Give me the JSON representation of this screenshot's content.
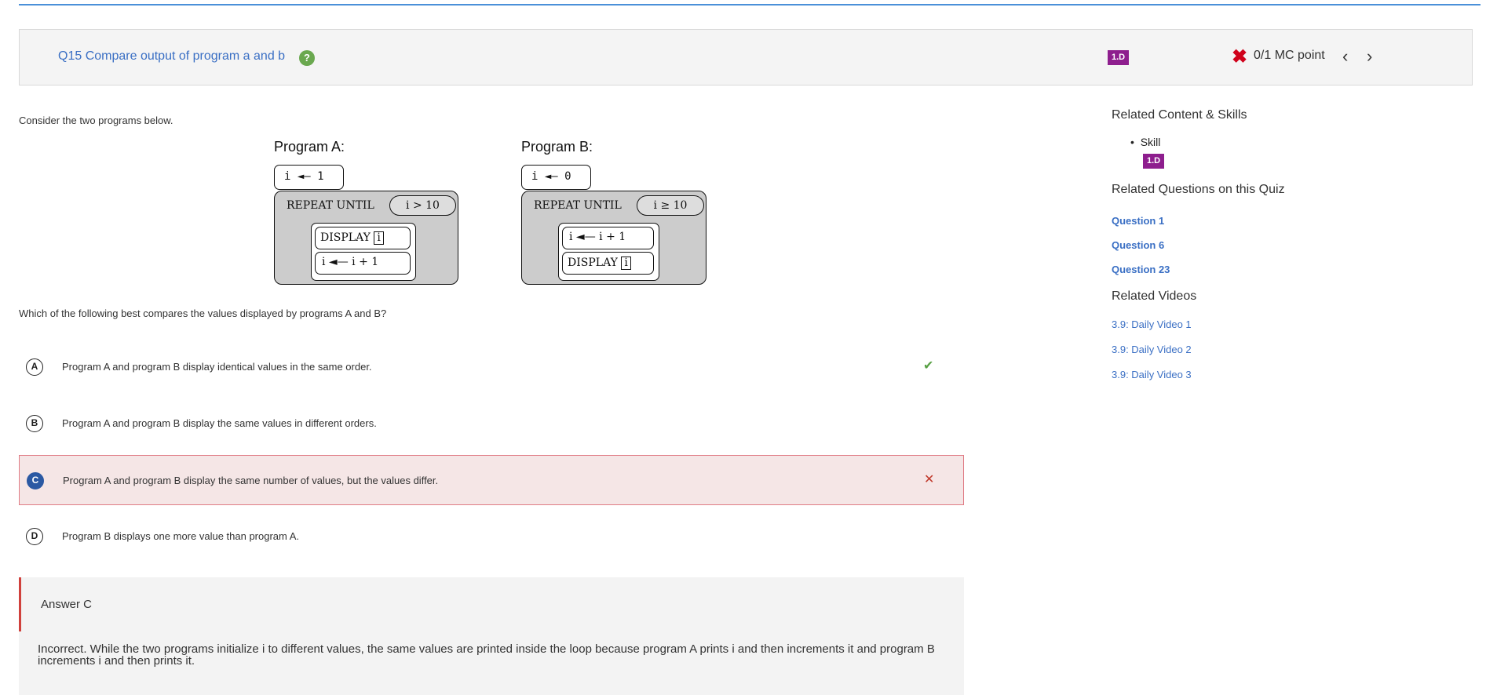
{
  "question": {
    "title": "Q15 Compare output of program a and b",
    "help_icon": "question-icon",
    "skill_badge": "1.D",
    "score": "0/1 MC point",
    "score_icon": "x-icon",
    "prev_icon": "chevron-left-icon",
    "next_icon": "chevron-right-icon"
  },
  "body": {
    "consider": "Consider the two programs below.",
    "which": "Which of the following best compares the values displayed by programs A and B?"
  },
  "programA": {
    "title": "Program A:",
    "init": "i ◄— 1",
    "loop_label": "REPEAT UNTIL",
    "condition": "i > 10",
    "stmt1_kw": "DISPLAY",
    "stmt1_var": "i",
    "stmt2": "i ◄— i + 1"
  },
  "programB": {
    "title": "Program B:",
    "init": "i ◄— 0",
    "loop_label": "REPEAT UNTIL",
    "condition": "i ≥ 10",
    "stmt1": "i ◄— i + 1",
    "stmt2_kw": "DISPLAY",
    "stmt2_var": "i"
  },
  "options": [
    {
      "letter": "A",
      "text": "Program A and program B display identical values in the same order.",
      "mark": "✔"
    },
    {
      "letter": "B",
      "text": "Program A and program B display the same values in different orders.",
      "mark": ""
    },
    {
      "letter": "C",
      "text": "Program A and program B display the same number of values, but the values differ.",
      "mark": "✕"
    },
    {
      "letter": "D",
      "text": "Program B displays one more value than program A.",
      "mark": ""
    }
  ],
  "answer": {
    "label": "Answer C",
    "text": "Incorrect. While the two programs initialize i to different values, the same values are printed inside the loop because program A prints i and then increments it and program B increments i and then prints it."
  },
  "sidebar": {
    "related_content": "Related Content & Skills",
    "skill_label": "Skill",
    "skill_badge": "1.D",
    "related_questions": "Related Questions on this Quiz",
    "questions": [
      "Question 1",
      "Question 6",
      "Question 23"
    ],
    "related_videos": "Related Videos",
    "videos": [
      "3.9: Daily Video 1",
      "3.9: Daily Video 2",
      "3.9: Daily Video 3"
    ]
  },
  "colors": {
    "accent": "#3a6fc4",
    "badge": "#8e1e8e",
    "correct": "#58a044",
    "incorrect": "#c0392b",
    "selected": "#2b59a3"
  }
}
